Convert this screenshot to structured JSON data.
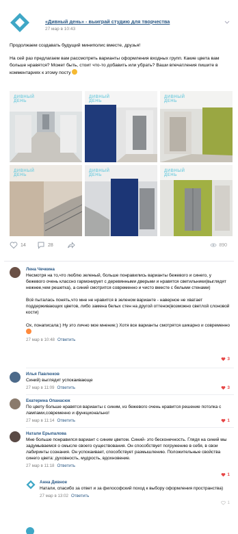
{
  "post": {
    "title": "«Дивный день» - выиграй студию для творчества",
    "date": "27 мар в 10:43",
    "paragraphs": [
      "Продолжаем создавать будущий миниполис вместе, друзья!",
      "На сей раз предлагаем вам рассмотреть варианты оформления входных групп. Какие цвета вам больше нравятся? Может быть, стоит что-то добавить или убрать? Ваши впечатления пишите в комментариях к этому посту"
    ],
    "photo_caption_line1": "ДИВНЫЙ",
    "photo_caption_line2": "ДЕНЬ",
    "likes": "14",
    "comments_count": "28",
    "views": "890",
    "colors": {
      "link": "#2a5885",
      "like": "#e64646",
      "brand": "#3fa7c6"
    }
  },
  "comments": [
    {
      "author": "Лена Чечкина",
      "paragraphs": [
        "Несмотря на то,что люблю зеленый, больше понравились варианты бежевого и синего, у бежевого очень классно гармонирует с деревянными дверьми и нравятся светильники(выглядят нежнее,чем решетка), а синий смотрится современно и чисто вместе с белыми стенами)",
        "Всё пыталась понять,что мне не нравится в зеленом варианте - наверное не хватает поддерживающих цветов, либо замена белых стен на другой оттенок(возможно светлой слоновой кости)",
        "Ох, понаписала:) Ну это лично мое мнение;) Хотя все варианты смотрятся шикарно и современно"
      ],
      "date": "27 мар в 10:48",
      "reply": "Ответить",
      "likes": "3"
    },
    {
      "author": "Илья Павлюков",
      "paragraphs": [
        "Синий) выглядит успокаивающе"
      ],
      "date": "27 мар в 11:09",
      "reply": "Ответить",
      "likes": "3"
    },
    {
      "author": "Екатерина Опанасюк",
      "paragraphs": [
        "По цвету больше нравятся варианты с синим, из бежевого очень нравится решение потолка с лампами,современно и функционально!"
      ],
      "date": "27 мар в 11:14",
      "reply": "Ответить",
      "likes": "1"
    },
    {
      "author": "Натали Ерыпалова",
      "paragraphs": [
        "Мне больше понравился вариант с синим цветом. Синий- это бесконечность. Глядя на синий мы задумываемся о смысле своего существования. Он способствует погружению в себя, в свои лабиринты сознания. Он успокаивает, способствует размышлению. Положительные свойства синего цвета: духовность, мудрость, вдохновение."
      ],
      "date": "27 мар в 11:18",
      "reply": "Ответить",
      "likes": "1"
    },
    {
      "author": "Анна Дивное",
      "paragraphs": [
        "Натали, спасибо за ответ и за философский поход к выбору оформления пространства)"
      ],
      "date": "27 мар в 13:02",
      "reply": "Ответить",
      "likes": "1"
    }
  ]
}
